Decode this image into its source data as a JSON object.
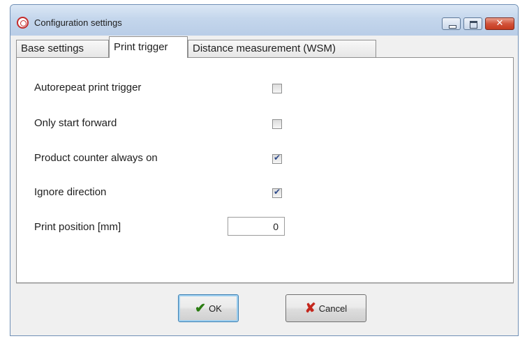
{
  "window": {
    "title": "Configuration settings",
    "icon": "app-logo-icon",
    "controls": {
      "minimize": "minimize-icon",
      "maximize": "maximize-icon",
      "close": "✕"
    }
  },
  "tabs": [
    {
      "label": "Base settings",
      "active": false
    },
    {
      "label": "Print trigger",
      "active": true
    },
    {
      "label": "Distance measurement (WSM)",
      "active": false
    }
  ],
  "options": [
    {
      "label": "Autorepeat print trigger",
      "checked": false
    },
    {
      "label": "Only start forward",
      "checked": false
    },
    {
      "label": "Product counter always on",
      "checked": true
    },
    {
      "label": "Ignore direction",
      "checked": true
    }
  ],
  "print_position": {
    "label": "Print position [mm]",
    "value": "0"
  },
  "buttons": {
    "ok": {
      "label": "OK",
      "icon": "✔"
    },
    "cancel": {
      "label": "Cancel",
      "icon": "✘"
    }
  },
  "colors": {
    "check_mark": "#2e4a8a",
    "ok_icon": "#2a7c12",
    "cancel_icon": "#c4271d",
    "close_button": "#c53a1e"
  }
}
